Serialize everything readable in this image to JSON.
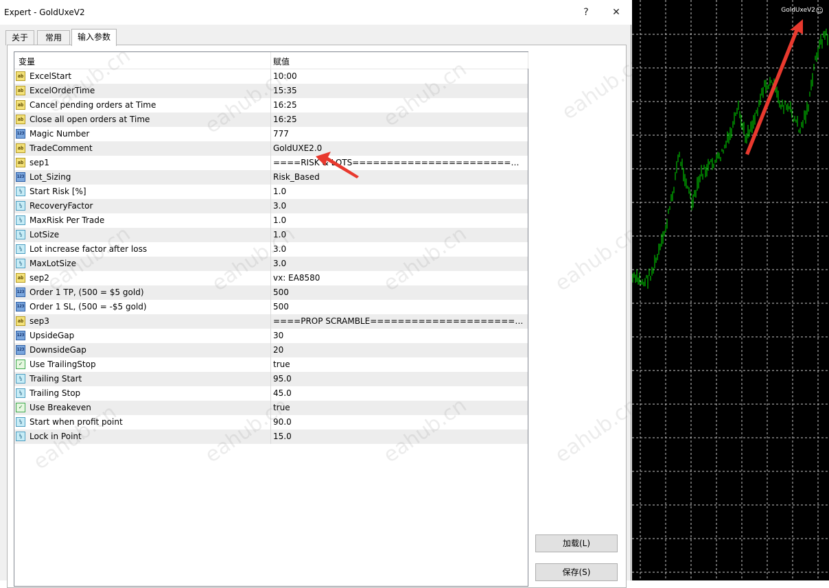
{
  "window": {
    "title": "Expert - GoldUxeV2",
    "help_label": "?",
    "close_label": "✕"
  },
  "tabs": [
    {
      "label": "关于"
    },
    {
      "label": "常用"
    },
    {
      "label": "输入参数"
    }
  ],
  "grid": {
    "col_variable": "变量",
    "col_value": "赋值",
    "rows": [
      {
        "type": "ab",
        "icon_text": "ab",
        "name": "ExcelStart",
        "value": "10:00"
      },
      {
        "type": "ab",
        "icon_text": "ab",
        "name": "ExcelOrderTime",
        "value": "15:35"
      },
      {
        "type": "ab",
        "icon_text": "ab",
        "name": "Cancel pending orders at Time",
        "value": "16:25"
      },
      {
        "type": "ab",
        "icon_text": "ab",
        "name": "Close all open orders at Time",
        "value": "16:25"
      },
      {
        "type": "num",
        "icon_text": "123",
        "name": "Magic Number",
        "value": "777"
      },
      {
        "type": "ab",
        "icon_text": "ab",
        "name": "TradeComment",
        "value": "GoldUXE2.0"
      },
      {
        "type": "ab",
        "icon_text": "ab",
        "name": "sep1",
        "value": "====RISK & LOTS===================================..."
      },
      {
        "type": "num",
        "icon_text": "123",
        "name": "Lot_Sizing",
        "value": "Risk_Based"
      },
      {
        "type": "dbl",
        "icon_text": "½",
        "name": "Start Risk [%]",
        "value": "1.0"
      },
      {
        "type": "dbl",
        "icon_text": "½",
        "name": "RecoveryFactor",
        "value": "3.0"
      },
      {
        "type": "dbl",
        "icon_text": "½",
        "name": "MaxRisk Per Trade",
        "value": "1.0"
      },
      {
        "type": "dbl",
        "icon_text": "½",
        "name": "LotSize",
        "value": "1.0"
      },
      {
        "type": "dbl",
        "icon_text": "½",
        "name": "Lot increase factor after loss",
        "value": "3.0"
      },
      {
        "type": "dbl",
        "icon_text": "½",
        "name": "MaxLotSize",
        "value": "3.0"
      },
      {
        "type": "ab",
        "icon_text": "ab",
        "name": "sep2",
        "value": "vx: EA8580"
      },
      {
        "type": "num",
        "icon_text": "123",
        "name": "Order 1 TP, (500 = $5 gold)",
        "value": "500"
      },
      {
        "type": "num",
        "icon_text": "123",
        "name": "Order 1 SL, (500 = -$5 gold)",
        "value": "500"
      },
      {
        "type": "ab",
        "icon_text": "ab",
        "name": "sep3",
        "value": "====PROP SCRAMBLE==============================..."
      },
      {
        "type": "num",
        "icon_text": "123",
        "name": "UpsideGap",
        "value": "30"
      },
      {
        "type": "num",
        "icon_text": "123",
        "name": "DownsideGap",
        "value": "20"
      },
      {
        "type": "bool",
        "icon_text": "✓",
        "name": "Use TrailingStop",
        "value": "true"
      },
      {
        "type": "dbl",
        "icon_text": "½",
        "name": "Trailing Start",
        "value": "95.0"
      },
      {
        "type": "dbl",
        "icon_text": "½",
        "name": "Trailing Stop",
        "value": "45.0"
      },
      {
        "type": "bool",
        "icon_text": "✓",
        "name": "Use Breakeven",
        "value": "true"
      },
      {
        "type": "dbl",
        "icon_text": "½",
        "name": "Start when profit point",
        "value": "90.0"
      },
      {
        "type": "dbl",
        "icon_text": "½",
        "name": "Lock in Point",
        "value": "15.0"
      }
    ]
  },
  "buttons": {
    "load_label": "加载(L)",
    "save_label": "保存(S)"
  },
  "chart": {
    "label": "GoldUxeV2",
    "smiley": "☺",
    "background": "#000000",
    "grid_color": "#c8c8c8",
    "bar_color": "#00e000",
    "arrow_color": "#e8392e"
  },
  "watermark": {
    "text": "eahub.cn"
  }
}
